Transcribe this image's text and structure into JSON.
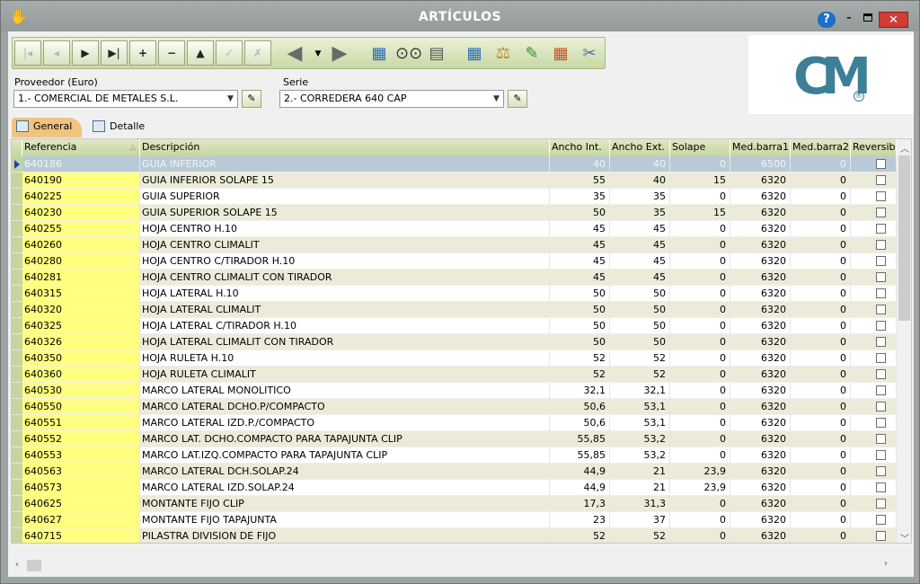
{
  "window": {
    "title": "ARTÍCULOS",
    "help_label": "?",
    "minimize_label": "–",
    "close_label": "✕"
  },
  "toolbar": {
    "nav_buttons": [
      {
        "icon": "first-record-icon",
        "glyph": "|◂"
      },
      {
        "icon": "prev-record-icon",
        "glyph": "◂"
      },
      {
        "icon": "next-record-icon",
        "glyph": "▶"
      },
      {
        "icon": "last-record-icon",
        "glyph": "▶|"
      },
      {
        "icon": "add-record-icon",
        "glyph": "+"
      },
      {
        "icon": "delete-record-icon",
        "glyph": "−"
      },
      {
        "icon": "edit-record-icon",
        "glyph": "▲"
      },
      {
        "icon": "post-record-icon",
        "glyph": "✓"
      },
      {
        "icon": "cancel-record-icon",
        "glyph": "✗"
      }
    ]
  },
  "filters": {
    "proveedor_label": "Proveedor (Euro)",
    "proveedor_value": "1.- COMERCIAL DE METALES S.L.",
    "serie_label": "Serie",
    "serie_value": "2.- CORREDERA 640 CAP"
  },
  "tabs": [
    {
      "label": "General",
      "active": true
    },
    {
      "label": "Detalle",
      "active": false
    }
  ],
  "grid": {
    "columns": [
      "Referencia",
      "Descripción",
      "Ancho Int.",
      "Ancho Ext.",
      "Solape",
      "Med.barra1",
      "Med.barra2",
      "Reversible"
    ],
    "rows": [
      {
        "ref": "640186",
        "desc": "GUIA INFERIOR",
        "ai": "40",
        "ae": "40",
        "sol": "0",
        "mb1": "6500",
        "mb2": "0"
      },
      {
        "ref": "640190",
        "desc": "GUIA INFERIOR SOLAPE 15",
        "ai": "55",
        "ae": "40",
        "sol": "15",
        "mb1": "6320",
        "mb2": "0"
      },
      {
        "ref": "640225",
        "desc": "GUIA SUPERIOR",
        "ai": "35",
        "ae": "35",
        "sol": "0",
        "mb1": "6320",
        "mb2": "0"
      },
      {
        "ref": "640230",
        "desc": "GUIA SUPERIOR SOLAPE 15",
        "ai": "50",
        "ae": "35",
        "sol": "15",
        "mb1": "6320",
        "mb2": "0"
      },
      {
        "ref": "640255",
        "desc": "HOJA CENTRO H.10",
        "ai": "45",
        "ae": "45",
        "sol": "0",
        "mb1": "6320",
        "mb2": "0"
      },
      {
        "ref": "640260",
        "desc": "HOJA CENTRO CLIMALIT",
        "ai": "45",
        "ae": "45",
        "sol": "0",
        "mb1": "6320",
        "mb2": "0"
      },
      {
        "ref": "640280",
        "desc": "HOJA CENTRO C/TIRADOR H.10",
        "ai": "45",
        "ae": "45",
        "sol": "0",
        "mb1": "6320",
        "mb2": "0"
      },
      {
        "ref": "640281",
        "desc": "HOJA CENTRO CLIMALIT CON TIRADOR",
        "ai": "45",
        "ae": "45",
        "sol": "0",
        "mb1": "6320",
        "mb2": "0"
      },
      {
        "ref": "640315",
        "desc": "HOJA LATERAL H.10",
        "ai": "50",
        "ae": "50",
        "sol": "0",
        "mb1": "6320",
        "mb2": "0"
      },
      {
        "ref": "640320",
        "desc": "HOJA LATERAL CLIMALIT",
        "ai": "50",
        "ae": "50",
        "sol": "0",
        "mb1": "6320",
        "mb2": "0"
      },
      {
        "ref": "640325",
        "desc": "HOJA LATERAL C/TIRADOR H.10",
        "ai": "50",
        "ae": "50",
        "sol": "0",
        "mb1": "6320",
        "mb2": "0"
      },
      {
        "ref": "640326",
        "desc": "HOJA LATERAL CLIMALIT CON TIRADOR",
        "ai": "50",
        "ae": "50",
        "sol": "0",
        "mb1": "6320",
        "mb2": "0"
      },
      {
        "ref": "640350",
        "desc": "HOJA RULETA H.10",
        "ai": "52",
        "ae": "52",
        "sol": "0",
        "mb1": "6320",
        "mb2": "0"
      },
      {
        "ref": "640360",
        "desc": "HOJA RULETA CLIMALIT",
        "ai": "52",
        "ae": "52",
        "sol": "0",
        "mb1": "6320",
        "mb2": "0"
      },
      {
        "ref": "640530",
        "desc": "MARCO LATERAL MONOLITICO",
        "ai": "32,1",
        "ae": "32,1",
        "sol": "0",
        "mb1": "6320",
        "mb2": "0"
      },
      {
        "ref": "640550",
        "desc": "MARCO LATERAL DCHO.P/COMPACTO",
        "ai": "50,6",
        "ae": "53,1",
        "sol": "0",
        "mb1": "6320",
        "mb2": "0"
      },
      {
        "ref": "640551",
        "desc": "MARCO LATERAL IZD.P./COMPACTO",
        "ai": "50,6",
        "ae": "53,1",
        "sol": "0",
        "mb1": "6320",
        "mb2": "0"
      },
      {
        "ref": "640552",
        "desc": "MARCO LAT. DCHO.COMPACTO PARA TAPAJUNTA CLIP",
        "ai": "55,85",
        "ae": "53,2",
        "sol": "0",
        "mb1": "6320",
        "mb2": "0"
      },
      {
        "ref": "640553",
        "desc": "MARCO LAT.IZQ.COMPACTO PARA TAPAJUNTA CLIP",
        "ai": "55,85",
        "ae": "53,2",
        "sol": "0",
        "mb1": "6320",
        "mb2": "0"
      },
      {
        "ref": "640563",
        "desc": "MARCO LATERAL DCH.SOLAP.24",
        "ai": "44,9",
        "ae": "21",
        "sol": "23,9",
        "mb1": "6320",
        "mb2": "0"
      },
      {
        "ref": "640573",
        "desc": "MARCO LATERAL IZD.SOLAP.24",
        "ai": "44,9",
        "ae": "21",
        "sol": "23,9",
        "mb1": "6320",
        "mb2": "0"
      },
      {
        "ref": "640625",
        "desc": "MONTANTE FIJO CLIP",
        "ai": "17,3",
        "ae": "31,3",
        "sol": "0",
        "mb1": "6320",
        "mb2": "0"
      },
      {
        "ref": "640627",
        "desc": "MONTANTE FIJO TAPAJUNTA",
        "ai": "23",
        "ae": "37",
        "sol": "0",
        "mb1": "6320",
        "mb2": "0"
      },
      {
        "ref": "640715",
        "desc": "PILASTRA DIVISION DE FIJO",
        "ai": "52",
        "ae": "52",
        "sol": "0",
        "mb1": "6320",
        "mb2": "0"
      }
    ]
  },
  "logo": {
    "text": "CM",
    "mark": "®"
  }
}
